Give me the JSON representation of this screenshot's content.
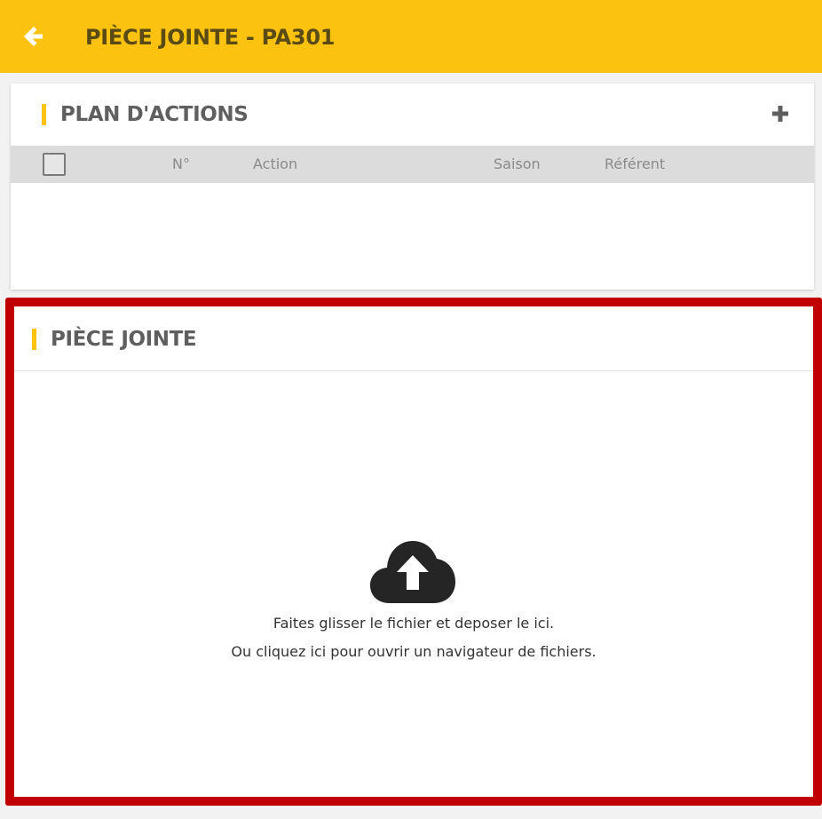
{
  "header": {
    "title": "PIÈCE JOINTE - PA301",
    "back_icon": "arrow-left-icon"
  },
  "plan_actions": {
    "title": "PLAN D'ACTIONS",
    "add_icon": "plus-icon",
    "columns": [
      "N°",
      "Action",
      "Saison",
      "Référent"
    ],
    "rows": []
  },
  "attachment": {
    "title": "PIÈCE JOINTE",
    "upload_icon": "cloud-upload-icon",
    "drop_text_1": "Faites glisser le fichier et deposer le ici.",
    "drop_text_2": "Ou cliquez ici pour ouvrir un navigateur de fichiers."
  },
  "colors": {
    "accent": "#fbc20f",
    "highlight_border": "#c00000"
  }
}
